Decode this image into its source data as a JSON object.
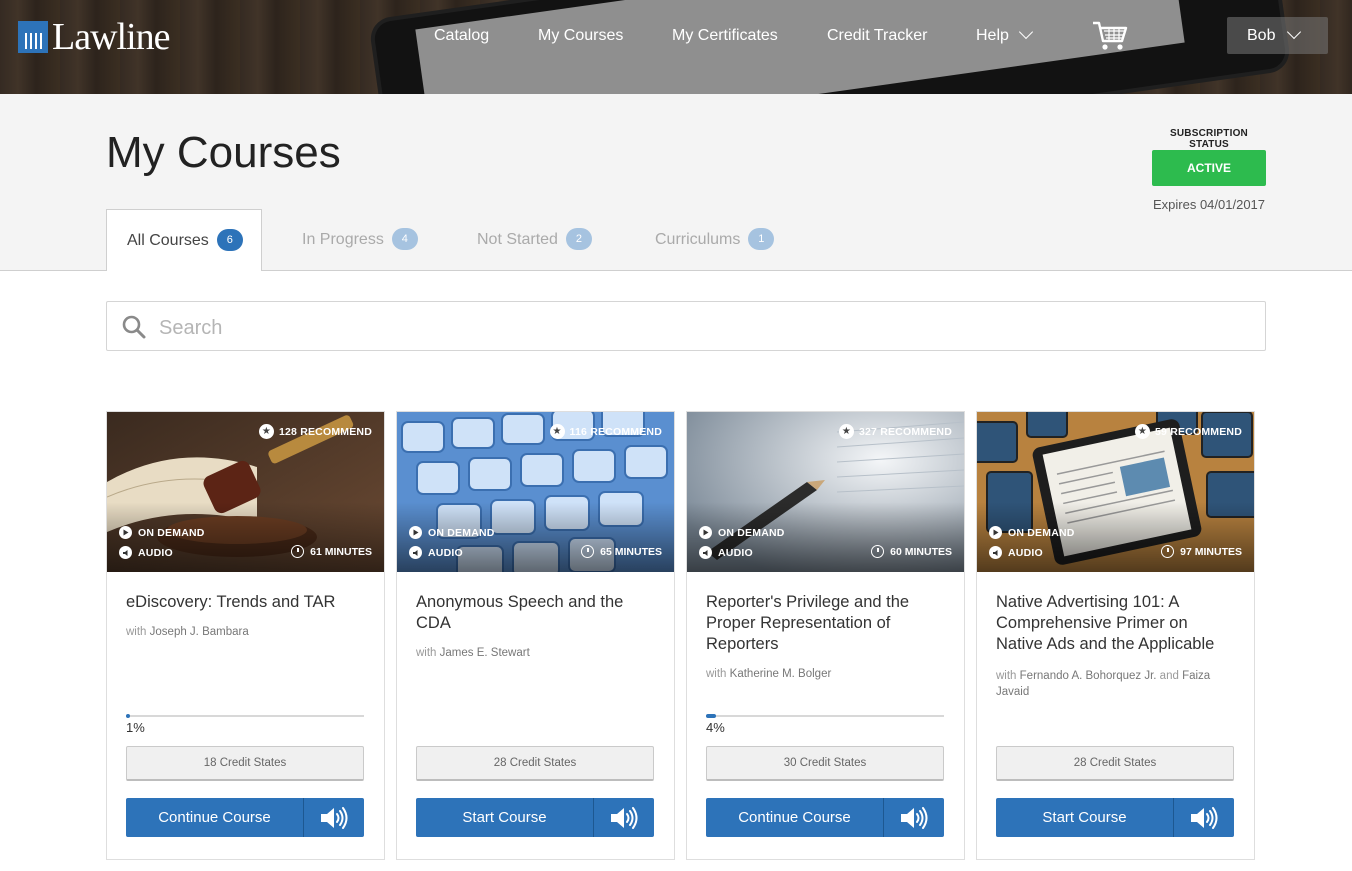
{
  "header": {
    "logo_text": "Lawline",
    "nav": [
      {
        "label": "Catalog"
      },
      {
        "label": "My Courses"
      },
      {
        "label": "My Certificates"
      },
      {
        "label": "Credit Tracker"
      },
      {
        "label": "Help"
      }
    ],
    "user_name": "Bob"
  },
  "page": {
    "title": "My Courses",
    "subscription_label": "SUBSCRIPTION STATUS",
    "subscription_status": "ACTIVE",
    "expires": "Expires 04/01/2017"
  },
  "tabs": [
    {
      "label": "All Courses",
      "count": "6"
    },
    {
      "label": "In Progress",
      "count": "4"
    },
    {
      "label": "Not Started",
      "count": "2"
    },
    {
      "label": "Curriculums",
      "count": "1"
    }
  ],
  "search": {
    "placeholder": "Search",
    "value": ""
  },
  "courses": [
    {
      "recommend": "128 RECOMMEND",
      "format": "ON DEMAND",
      "media": "AUDIO",
      "minutes": "61 MINUTES",
      "title": "eDiscovery: Trends and TAR",
      "with": "with",
      "instructor": "Joseph J. Bambara",
      "progress": 1,
      "progress_label": "1%",
      "credit_states": "18 Credit States",
      "action": "Continue Course"
    },
    {
      "recommend": "116 RECOMMEND",
      "format": "ON DEMAND",
      "media": "AUDIO",
      "minutes": "65 MINUTES",
      "title": "Anonymous Speech and the CDA",
      "with": "with",
      "instructor": "James E. Stewart",
      "credit_states": "28 Credit States",
      "action": "Start Course"
    },
    {
      "recommend": "327 RECOMMEND",
      "format": "ON DEMAND",
      "media": "AUDIO",
      "minutes": "60 MINUTES",
      "title": "Reporter's Privilege and the Proper Representation of Reporters",
      "with": "with",
      "instructor": "Katherine M. Bolger",
      "progress": 4,
      "progress_label": "4%",
      "credit_states": "30 Credit States",
      "action": "Continue Course"
    },
    {
      "recommend": "59 RECOMMEND",
      "format": "ON DEMAND",
      "media": "AUDIO",
      "minutes": "97 MINUTES",
      "title": "Native Advertising 101: A Comprehensive Primer on Native Ads and the Applicable",
      "with": "with",
      "instructor": "Fernando A. Bohorquez Jr.",
      "and": "and",
      "instructor2": "Faiza Javaid",
      "credit_states": "28 Credit States",
      "action": "Start Course"
    }
  ],
  "colors": {
    "primary": "#2d73b9",
    "active_green": "#2dbb4e",
    "badge_light": "#a6c3e0"
  }
}
